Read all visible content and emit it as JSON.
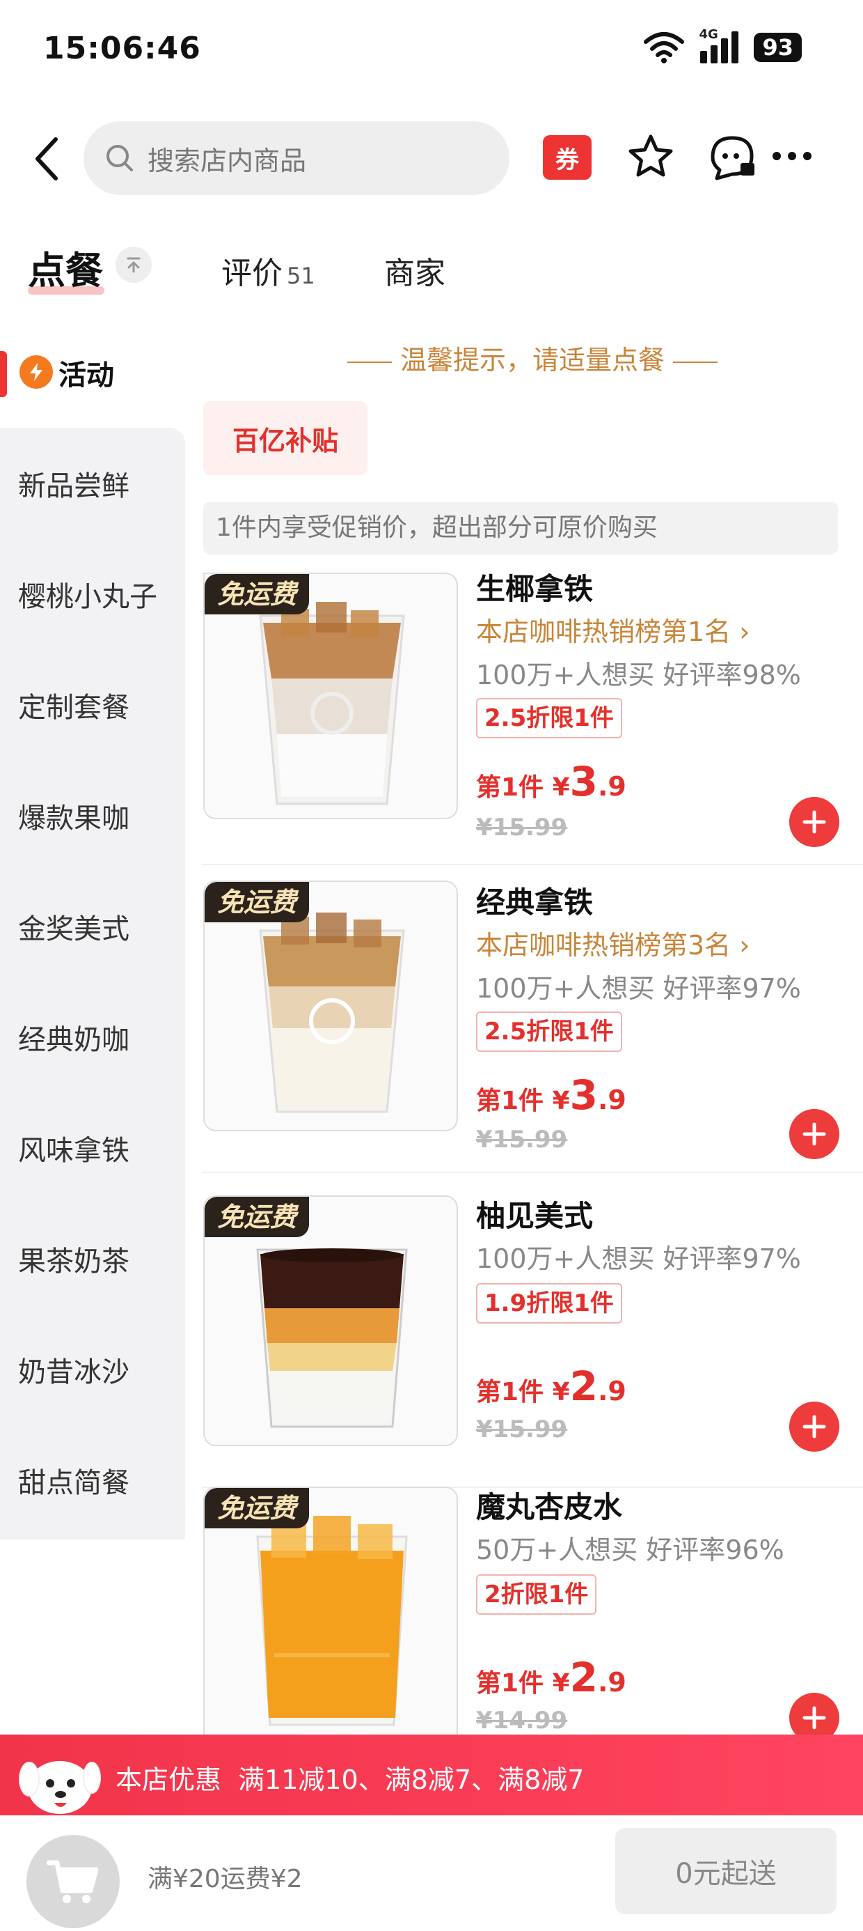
{
  "status_bar": {
    "time": "15:06:46",
    "network": "4G",
    "battery": "93"
  },
  "header": {
    "search_placeholder": "搜索店内商品",
    "coupon_label": "券"
  },
  "tabs": {
    "order": "点餐",
    "reviews": "评价",
    "reviews_count": "51",
    "merchant": "商家"
  },
  "sidebar": {
    "active": "活动",
    "items": [
      "新品尝鲜",
      "樱桃小丸子",
      "定制套餐",
      "爆款果咖",
      "金奖美式",
      "经典奶咖",
      "风味拿铁",
      "果茶奶茶",
      "奶昔冰沙",
      "甜点简餐"
    ]
  },
  "content": {
    "tip": "温馨提示，请适量点餐",
    "subsidy_tag": "百亿补贴",
    "promo_note": "1件内享受促销价，超出部分可原价购买",
    "products": [
      {
        "badge": "免运费",
        "name": "生椰拿铁",
        "rank": "本店咖啡热销榜第1名 ›",
        "stat": "100万+人想买  好评率98%",
        "discount": "2.5折限1件",
        "price_prefix": "第1件 ¥",
        "price_int": "3",
        "price_dec": ".9",
        "original": "¥15.99"
      },
      {
        "badge": "免运费",
        "name": "经典拿铁",
        "rank": "本店咖啡热销榜第3名 ›",
        "stat": "100万+人想买  好评率97%",
        "discount": "2.5折限1件",
        "price_prefix": "第1件 ¥",
        "price_int": "3",
        "price_dec": ".9",
        "original": "¥15.99"
      },
      {
        "badge": "免运费",
        "name": "柚见美式",
        "rank": "",
        "stat": "100万+人想买  好评率97%",
        "discount": "1.9折限1件",
        "price_prefix": "第1件 ¥",
        "price_int": "2",
        "price_dec": ".9",
        "original": "¥15.99"
      },
      {
        "badge": "免运费",
        "name": "魔丸杏皮水",
        "rank": "",
        "stat": "50万+人想买  好评率96%",
        "discount": "2折限1件",
        "price_prefix": "第1件 ¥",
        "price_int": "2",
        "price_dec": ".9",
        "original": "¥14.99"
      }
    ]
  },
  "promo_strip": {
    "label": "本店优惠",
    "offers": "满11减10、满8减7、满8减7"
  },
  "cart_bar": {
    "delivery_note": "满¥20运费¥2",
    "checkout_label": "0元起送"
  },
  "colors": {
    "accent": "#ee3333",
    "gold": "#c8853a",
    "badge_bg": "#2a221b"
  }
}
